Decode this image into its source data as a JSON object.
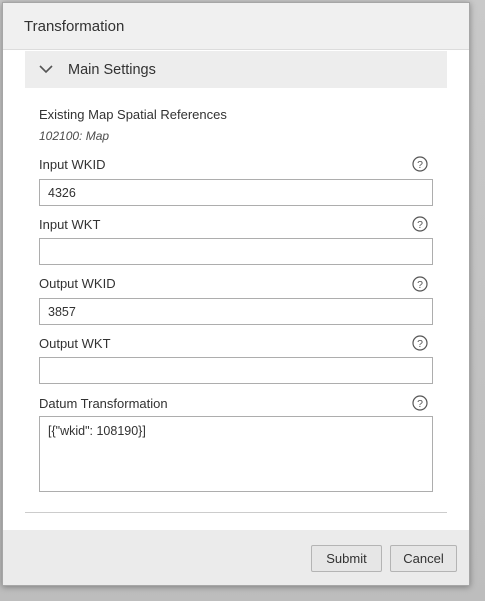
{
  "dialog": {
    "title": "Transformation"
  },
  "section": {
    "title": "Main Settings",
    "icon": "chevron-down-icon"
  },
  "spatial_refs": {
    "label": "Existing Map Spatial References",
    "value": "102100: Map"
  },
  "fields": {
    "input_wkid": {
      "label": "Input WKID",
      "value": "4326"
    },
    "input_wkt": {
      "label": "Input WKT",
      "value": ""
    },
    "output_wkid": {
      "label": "Output WKID",
      "value": "3857"
    },
    "output_wkt": {
      "label": "Output WKT",
      "value": ""
    },
    "datum_transformation": {
      "label": "Datum Transformation",
      "value": "[{\"wkid\": 108190}]"
    }
  },
  "help_icon": "question-circle-icon",
  "footer": {
    "submit_label": "Submit",
    "cancel_label": "Cancel"
  },
  "colors": {
    "header_bg": "#f0f0f0",
    "section_bg": "#ededed",
    "footer_bg": "#ebebeb",
    "button_bg": "#e6e6e6",
    "text": "#323232"
  }
}
